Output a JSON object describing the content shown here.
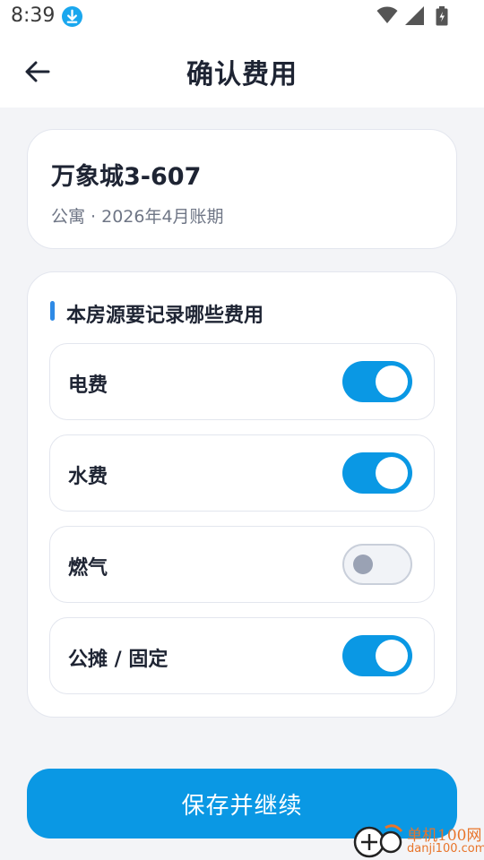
{
  "status_bar": {
    "time": "8:39",
    "icons": [
      "download-icon",
      "wifi-icon",
      "signal-icon",
      "battery-icon"
    ]
  },
  "header": {
    "title": "确认费用",
    "back_icon": "arrow-left-icon"
  },
  "property": {
    "name": "万象城3-607",
    "subtitle": "公寓 · 2026年4月账期"
  },
  "fees": {
    "section_title": "本房源要记录哪些费用",
    "items": [
      {
        "label": "电费",
        "enabled": true
      },
      {
        "label": "水费",
        "enabled": true
      },
      {
        "label": "燃气",
        "enabled": false
      },
      {
        "label": "公摊 / 固定",
        "enabled": true
      }
    ]
  },
  "footer": {
    "save_label": "保存并继续"
  },
  "watermark": {
    "brand": "单机100网",
    "domain": "danji100.com"
  },
  "colors": {
    "accent": "#0a98e4",
    "section_marker": "#2e8ae6",
    "background": "#f3f4f7",
    "watermark": "#e8742a"
  }
}
